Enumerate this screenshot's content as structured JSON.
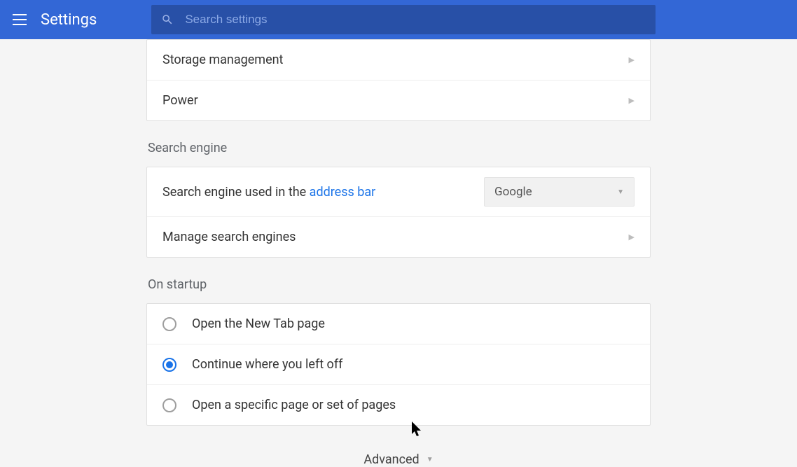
{
  "header": {
    "title": "Settings",
    "search_placeholder": "Search settings"
  },
  "system_section": {
    "items": [
      {
        "label": "Storage management"
      },
      {
        "label": "Power"
      }
    ]
  },
  "search_engine_section": {
    "title": "Search engine",
    "row_label_prefix": "Search engine used in the ",
    "row_label_link": "address bar",
    "selected_engine": "Google",
    "manage_label": "Manage search engines"
  },
  "startup_section": {
    "title": "On startup",
    "options": [
      {
        "label": "Open the New Tab page",
        "selected": false
      },
      {
        "label": "Continue where you left off",
        "selected": true
      },
      {
        "label": "Open a specific page or set of pages",
        "selected": false
      }
    ]
  },
  "advanced_label": "Advanced"
}
